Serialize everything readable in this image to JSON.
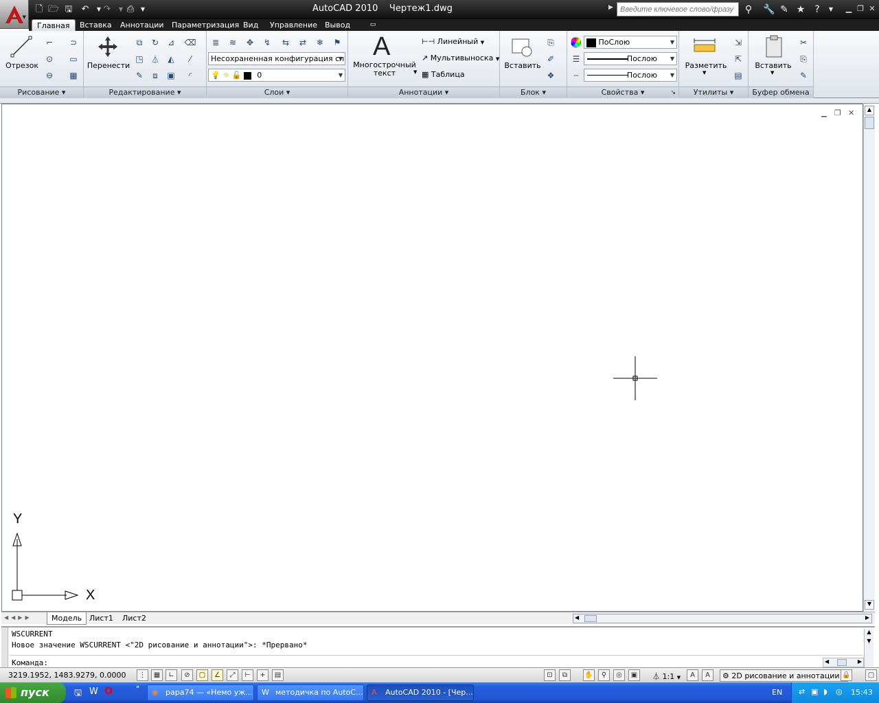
{
  "window": {
    "title": "AutoCAD 2010    Чертеж1.dwg",
    "search_placeholder": "Введите ключевое слово/фразу"
  },
  "tabs": [
    "Главная",
    "Вставка",
    "Аннотации",
    "Параметризация",
    "Вид",
    "Управление",
    "Вывод"
  ],
  "ribbon": {
    "draw": {
      "line_label": "Отрезок",
      "panel_label": "Рисование"
    },
    "modify": {
      "move_label": "Перенести",
      "panel_label": "Редактирование"
    },
    "layers": {
      "layer_state": "Несохраненная конфигурация слоев",
      "current_layer": "0",
      "panel_label": "Слои"
    },
    "annotation": {
      "mtext_label": "Многострочный\nтекст",
      "linear_label": "Линейный",
      "multileader_label": "Мультивыноска",
      "table_label": "Таблица",
      "panel_label": "Аннотации"
    },
    "block": {
      "insert_label": "Вставить",
      "panel_label": "Блок"
    },
    "properties": {
      "color": "ПоСлою",
      "lineweight": "Послою",
      "linetype": "Послою",
      "panel_label": "Свойства"
    },
    "utilities": {
      "measure_label": "Разметить",
      "panel_label": "Утилиты"
    },
    "clipboard": {
      "paste_label": "Вставить",
      "panel_label": "Буфер обмена"
    }
  },
  "ucs": {
    "y_label": "Y",
    "x_label": "X"
  },
  "layout_tabs": [
    "Модель",
    "Лист1",
    "Лист2"
  ],
  "command": {
    "history": [
      "WSCURRENT",
      "Новое значение WSCURRENT <\"2D рисование и аннотации\">: *Прервано*"
    ],
    "prompt": "Команда:"
  },
  "status": {
    "coords": "3219.1952, 1483.9279, 0.0000",
    "scale": "1:1",
    "workspace": "2D рисование и аннотации"
  },
  "taskbar": {
    "start": "пуск",
    "buttons": [
      "papa74 — «Немо уж...",
      "методичка по AutoC...",
      "AutoCAD 2010 - [Чер..."
    ],
    "lang": "EN",
    "clock": "15:43"
  }
}
